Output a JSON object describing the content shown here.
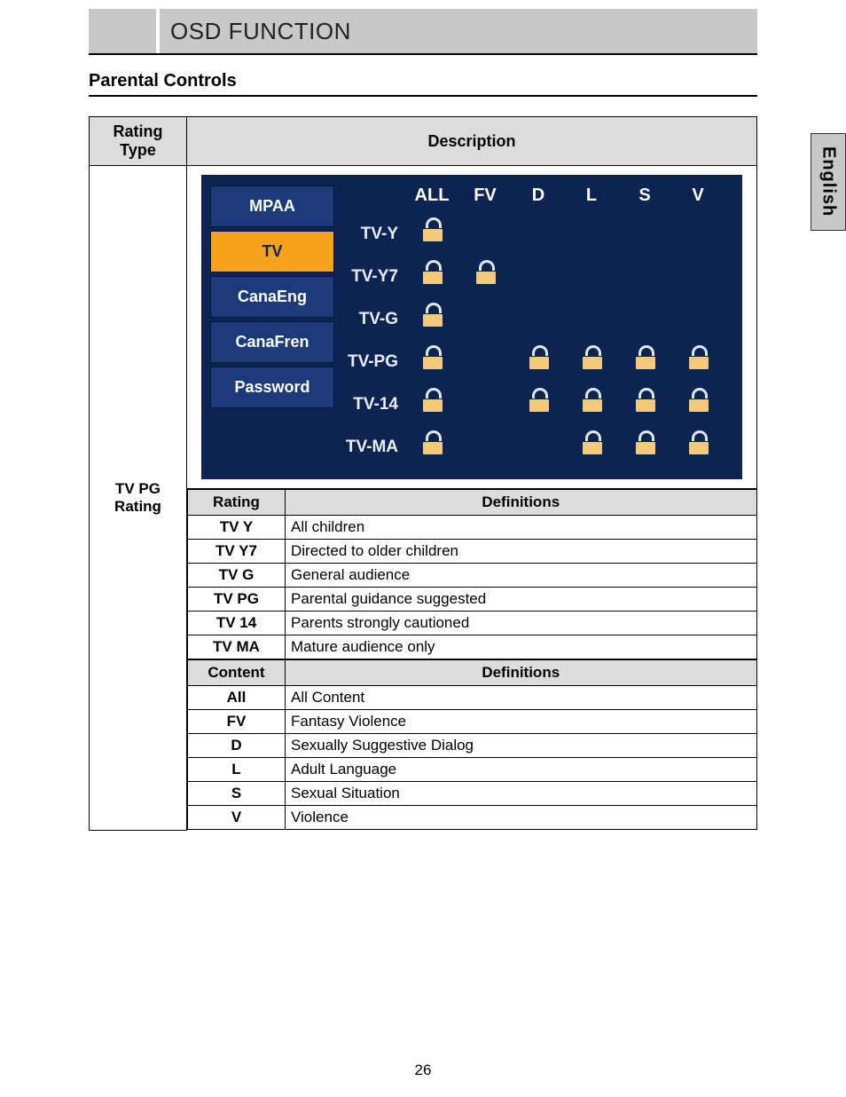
{
  "header": {
    "title": "OSD FUNCTION"
  },
  "subsection": {
    "title": "Parental Controls"
  },
  "language_tab": "English",
  "table_headers": {
    "rating_type": "Rating\nType",
    "description": "Description"
  },
  "rating_type_label": "TV PG Rating",
  "osd": {
    "menu": [
      "MPAA",
      "TV",
      "CanaEng",
      "CanaFren",
      "Password"
    ],
    "selected_index": 1,
    "columns": [
      "",
      "ALL",
      "FV",
      "D",
      "L",
      "S",
      "V"
    ],
    "rows": [
      {
        "label": "TV-Y",
        "locks": [
          true,
          false,
          false,
          false,
          false,
          false
        ]
      },
      {
        "label": "TV-Y7",
        "locks": [
          true,
          true,
          false,
          false,
          false,
          false
        ]
      },
      {
        "label": "TV-G",
        "locks": [
          true,
          false,
          false,
          false,
          false,
          false
        ]
      },
      {
        "label": "TV-PG",
        "locks": [
          true,
          false,
          true,
          true,
          true,
          true
        ]
      },
      {
        "label": "TV-14",
        "locks": [
          true,
          false,
          true,
          true,
          true,
          true
        ]
      },
      {
        "label": "TV-MA",
        "locks": [
          true,
          false,
          false,
          true,
          true,
          true
        ]
      }
    ]
  },
  "rating_defs": {
    "header_rating": "Rating",
    "header_def": "Definitions",
    "rows": [
      {
        "code": "TV Y",
        "def": "All children"
      },
      {
        "code": "TV Y7",
        "def": "Directed to older children"
      },
      {
        "code": "TV G",
        "def": "General audience"
      },
      {
        "code": "TV PG",
        "def": "Parental guidance suggested"
      },
      {
        "code": "TV 14",
        "def": "Parents strongly cautioned"
      },
      {
        "code": "TV MA",
        "def": "Mature audience only"
      }
    ]
  },
  "content_defs": {
    "header_content": "Content",
    "header_def": "Definitions",
    "rows": [
      {
        "code": "All",
        "def": "All Content"
      },
      {
        "code": "FV",
        "def": "Fantasy Violence"
      },
      {
        "code": "D",
        "def": "Sexually Suggestive Dialog"
      },
      {
        "code": "L",
        "def": "Adult Language"
      },
      {
        "code": "S",
        "def": "Sexual Situation"
      },
      {
        "code": "V",
        "def": "Violence"
      }
    ]
  },
  "page_number": "26"
}
